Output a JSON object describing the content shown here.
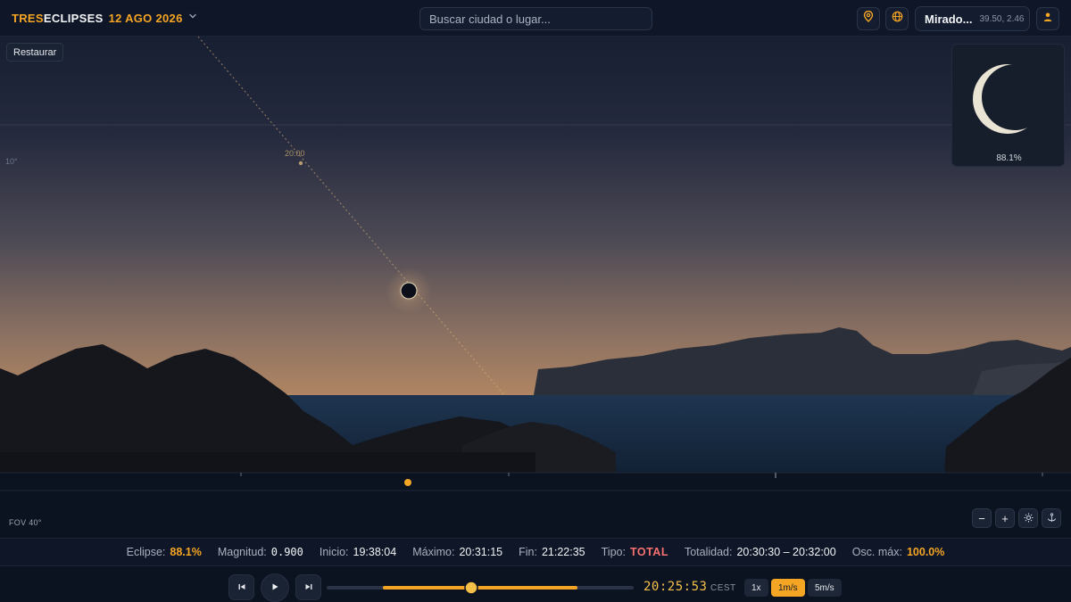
{
  "app": {
    "brand_part1": "TRES",
    "brand_part2": "ECLIPSES",
    "date": "12 AGO 2026"
  },
  "search": {
    "placeholder": "Buscar ciudad o lugar..."
  },
  "location": {
    "name": "Mirado...",
    "coords": "39.50, 2.46"
  },
  "scene": {
    "restore_label": "Restaurar",
    "altitude_label": "10°",
    "path_time_label": "20:00",
    "preview_percent": "88.1%",
    "fov_label": "FOV 40°",
    "sky_top": "#181f33",
    "sky_horizon": "#b88a62"
  },
  "controls": {
    "zoom_out": "−",
    "zoom_in": "+"
  },
  "stats": {
    "eclipse_label": "Eclipse:",
    "eclipse_value": "88.1%",
    "magnitude_label": "Magnitud:",
    "magnitude_value": "0.900",
    "start_label": "Inicio:",
    "start_value": "19:38:04",
    "max_label": "Máximo:",
    "max_value": "20:31:15",
    "end_label": "Fin:",
    "end_value": "21:22:35",
    "type_label": "Tipo:",
    "type_value": "TOTAL",
    "totality_label": "Totalidad:",
    "totality_value": "20:30:30 – 20:32:00",
    "maxdark_label": "Osc. máx:",
    "maxdark_value": "100.0%"
  },
  "playback": {
    "time": "20:25:53",
    "timezone": "CEST",
    "speeds": [
      "1x",
      "1m/s",
      "5m/s"
    ],
    "active_speed": "1m/s",
    "progress_fraction": 0.47
  },
  "colors": {
    "accent": "#f5a524",
    "type_total": "#f87171"
  }
}
